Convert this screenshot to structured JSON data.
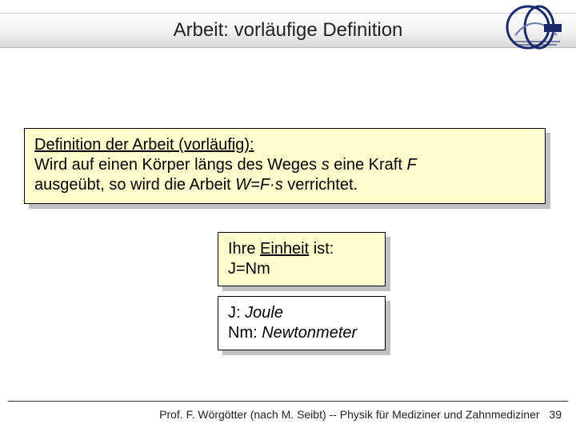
{
  "title": "Arbeit: vorläufige Definition",
  "definition": {
    "heading": "Definition der Arbeit (vorläufig):",
    "line1_a": "Wird auf einen Körper längs des Weges ",
    "line1_s": "s",
    "line1_b": " eine Kraft ",
    "line1_F": "F",
    "line2_a": "ausgeübt, so wird die Arbeit ",
    "line2_eq": "W=F·s",
    "line2_b": " verrichtet."
  },
  "unit": {
    "label_a": "Ihre ",
    "label_u": "Einheit",
    "label_b": " ist:",
    "value": "J=Nm"
  },
  "legend": {
    "j_label": "J: ",
    "j_name": "Joule",
    "nm_label": "Nm: ",
    "nm_name": "Newtonmeter"
  },
  "footer": {
    "text": "Prof. F. Wörgötter (nach M. Seibt) -- Physik für Mediziner und Zahnmediziner",
    "page": "39"
  }
}
